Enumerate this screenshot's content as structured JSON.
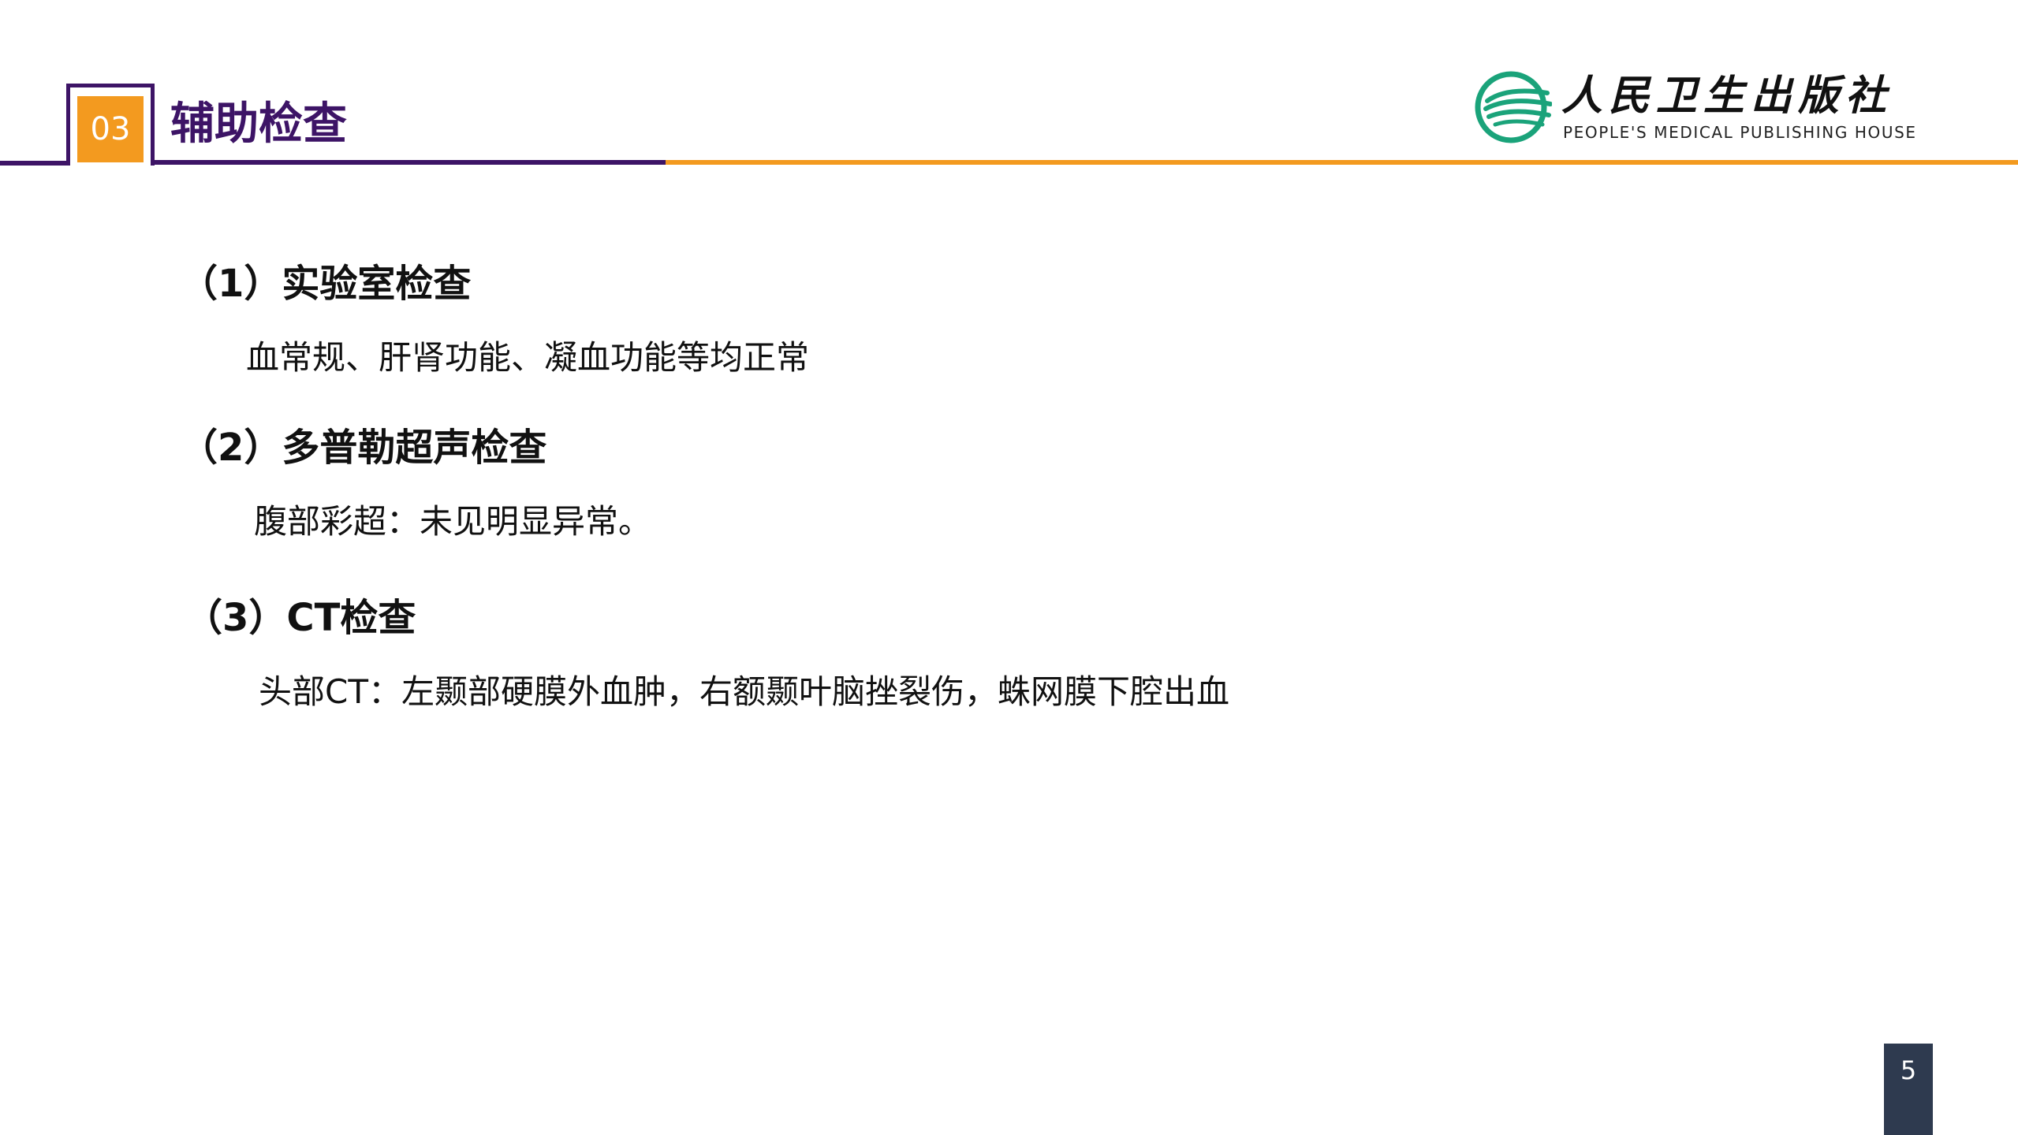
{
  "header": {
    "section_number": "03",
    "section_title": "辅助检查",
    "logo_cn": "人民卫生出版社",
    "logo_en": "PEOPLE'S MEDICAL PUBLISHING HOUSE"
  },
  "colors": {
    "purple": "#3d1466",
    "orange": "#f39a1f",
    "logo_teal": "#1aa37a",
    "page_badge": "#2e3a4f"
  },
  "content": {
    "sections": [
      {
        "heading": "（1）实验室检查",
        "body": "血常规、肝肾功能、凝血功能等均正常"
      },
      {
        "heading": "（2）多普勒超声检查",
        "body": "腹部彩超：未见明显异常。"
      },
      {
        "heading": "（3）CT检查",
        "body": "头部CT：左颞部硬膜外血肿，右额颞叶脑挫裂伤，蛛网膜下腔出血"
      }
    ]
  },
  "footer": {
    "page_number": "5"
  }
}
